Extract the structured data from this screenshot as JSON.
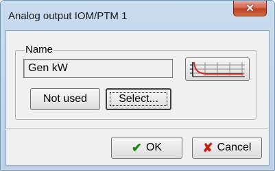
{
  "window": {
    "title": "Analog output IOM/PTM 1",
    "close_icon": "close-icon"
  },
  "group": {
    "label": "Name",
    "name_value": "Gen kW"
  },
  "buttons": {
    "not_used": "Not used",
    "select": "Select...",
    "ok": "OK",
    "cancel": "Cancel",
    "graph_icon": "curve-graph-icon",
    "ok_icon": "checkmark-icon",
    "cancel_icon": "red-x-icon"
  },
  "colors": {
    "curve": "#e0201b",
    "ok_check": "#1a8a16",
    "cancel_x": "#c91d10"
  }
}
